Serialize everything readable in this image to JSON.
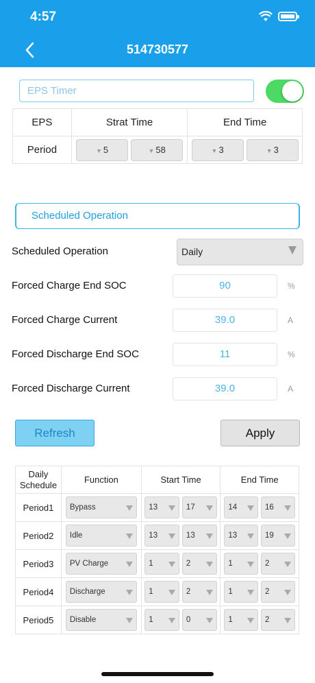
{
  "status": {
    "time": "4:57"
  },
  "header": {
    "title": "514730577"
  },
  "eps": {
    "placeholder": "EPS Timer",
    "toggle_on": true,
    "table": {
      "col_eps": "EPS",
      "col_start": "Strat Time",
      "col_end": "End Time",
      "row_label": "Period",
      "start_hour": "5",
      "start_min": "58",
      "end_hour": "3",
      "end_min": "3"
    }
  },
  "scheduled": {
    "banner": "Scheduled Operation",
    "mode_label": "Scheduled Operation",
    "mode_value": "Daily",
    "charge_soc_label": "Forced Charge End SOC",
    "charge_soc_value": "90",
    "charge_soc_unit": "%",
    "charge_current_label": "Forced Charge Current",
    "charge_current_value": "39.0",
    "charge_current_unit": "A",
    "discharge_soc_label": "Forced Discharge End SOC",
    "discharge_soc_value": "11",
    "discharge_soc_unit": "%",
    "discharge_current_label": "Forced Discharge Current",
    "discharge_current_value": "39.0",
    "discharge_current_unit": "A"
  },
  "buttons": {
    "refresh": "Refresh",
    "apply": "Apply"
  },
  "schedule_table": {
    "headers": {
      "period_line1": "Daily",
      "period_line2": "Schedule",
      "function": "Function",
      "start": "Start Time",
      "end": "End Time"
    },
    "rows": [
      {
        "period": "Period1",
        "function": "Bypass",
        "start_h": "13",
        "start_m": "17",
        "end_h": "14",
        "end_m": "16"
      },
      {
        "period": "Period2",
        "function": "Idle",
        "start_h": "13",
        "start_m": "13",
        "end_h": "13",
        "end_m": "19"
      },
      {
        "period": "Period3",
        "function": "PV Charge",
        "start_h": "1",
        "start_m": "2",
        "end_h": "1",
        "end_m": "2"
      },
      {
        "period": "Period4",
        "function": "Discharge",
        "start_h": "1",
        "start_m": "2",
        "end_h": "1",
        "end_m": "2"
      },
      {
        "period": "Period5",
        "function": "Disable",
        "start_h": "1",
        "start_m": "0",
        "end_h": "1",
        "end_m": "2"
      }
    ]
  }
}
